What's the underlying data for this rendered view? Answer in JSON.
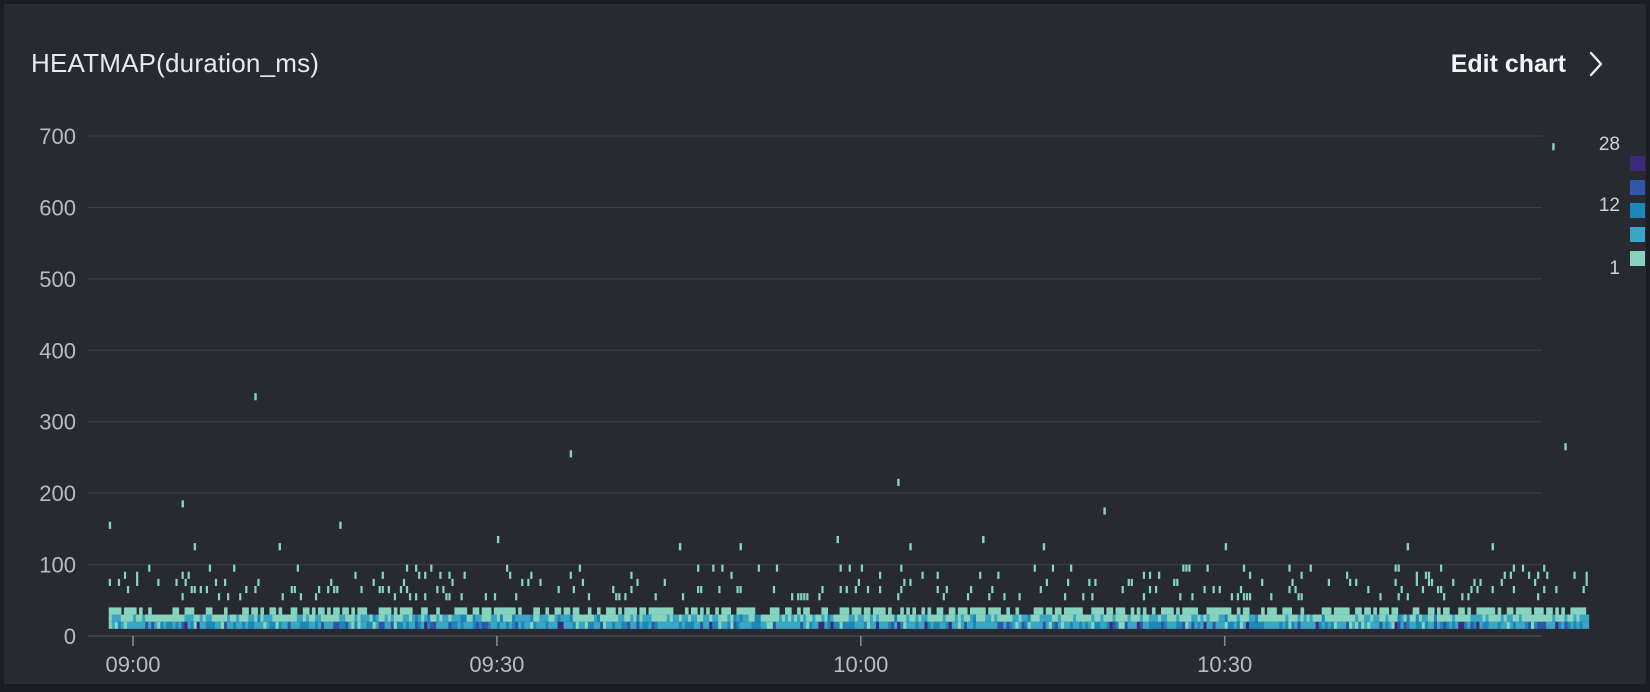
{
  "header": {
    "title": "HEATMAP(duration_ms)",
    "edit_label": "Edit chart",
    "edit_icon": "chevron-right-icon"
  },
  "chart_data": {
    "type": "heatmap",
    "title": "HEATMAP(duration_ms)",
    "xlabel": "",
    "ylabel": "",
    "x_ticks": [
      "09:00",
      "09:30",
      "10:00",
      "10:30"
    ],
    "x_range": [
      "08:58",
      "11:00"
    ],
    "y_ticks": [
      0,
      100,
      200,
      300,
      400,
      500,
      600,
      700
    ],
    "ylim": [
      0,
      700
    ],
    "bucket_ms": 10,
    "bucket_minutes": 0.25,
    "grid": true,
    "legend": {
      "position": "right",
      "labels": [
        "28",
        "12",
        "1"
      ],
      "colors": [
        "#3b2a7e",
        "#2f56a8",
        "#1f86b9",
        "#3aa6c6",
        "#86d3c0"
      ]
    },
    "baseline": {
      "note": "dense band in the 10-30 ms buckets across the full time range, counts mostly 2-12 with occasional peaks near 28",
      "bucket_10_20_typical_count": 8,
      "bucket_20_30_typical_count": 4
    },
    "cells": [
      {
        "t": "09:04",
        "y": 180,
        "count": 1
      },
      {
        "t": "08:58",
        "y": 150,
        "count": 1
      },
      {
        "t": "09:10",
        "y": 330,
        "count": 1
      },
      {
        "t": "09:17",
        "y": 150,
        "count": 1
      },
      {
        "t": "09:36",
        "y": 250,
        "count": 1
      },
      {
        "t": "09:30",
        "y": 130,
        "count": 1
      },
      {
        "t": "09:58",
        "y": 130,
        "count": 1
      },
      {
        "t": "10:03",
        "y": 210,
        "count": 1
      },
      {
        "t": "10:04",
        "y": 120,
        "count": 1
      },
      {
        "t": "10:10",
        "y": 130,
        "count": 1
      },
      {
        "t": "10:20",
        "y": 170,
        "count": 1
      },
      {
        "t": "10:57",
        "y": 680,
        "count": 1
      },
      {
        "t": "10:58",
        "y": 260,
        "count": 1
      },
      {
        "t": "09:05",
        "y": 120,
        "count": 1
      },
      {
        "t": "09:12",
        "y": 120,
        "count": 1
      },
      {
        "t": "09:45",
        "y": 120,
        "count": 1
      },
      {
        "t": "09:50",
        "y": 120,
        "count": 1
      },
      {
        "t": "10:15",
        "y": 120,
        "count": 1
      },
      {
        "t": "10:30",
        "y": 120,
        "count": 1
      },
      {
        "t": "10:45",
        "y": 120,
        "count": 1
      },
      {
        "t": "10:52",
        "y": 120,
        "count": 1
      }
    ]
  }
}
